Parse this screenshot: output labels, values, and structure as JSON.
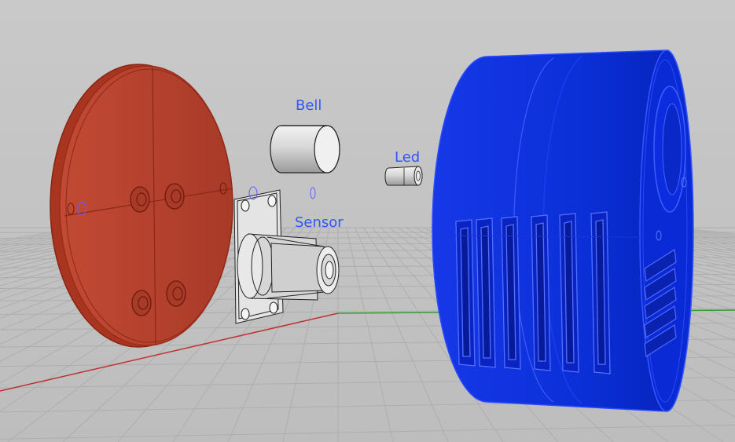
{
  "viewport": {
    "background_color": "#c5c5c5",
    "grid_color": "#b0b0b0",
    "x_axis_color": "#c03030",
    "y_axis_color": "#3a9a3a"
  },
  "labels": {
    "bell": "Bell",
    "led": "Led",
    "sensor": "Sensor"
  },
  "objects": [
    {
      "name": "front-cover-disc",
      "color": "#c0432a",
      "selected": true
    },
    {
      "name": "bell",
      "color": "#e9e9e9",
      "selected": false
    },
    {
      "name": "led",
      "color": "#e9e9e9",
      "selected": false
    },
    {
      "name": "sensor",
      "color": "#e9e9e9",
      "selected": false
    },
    {
      "name": "housing",
      "color": "#0a2ee6",
      "selected": true
    }
  ],
  "label_color": "#2f56ff"
}
